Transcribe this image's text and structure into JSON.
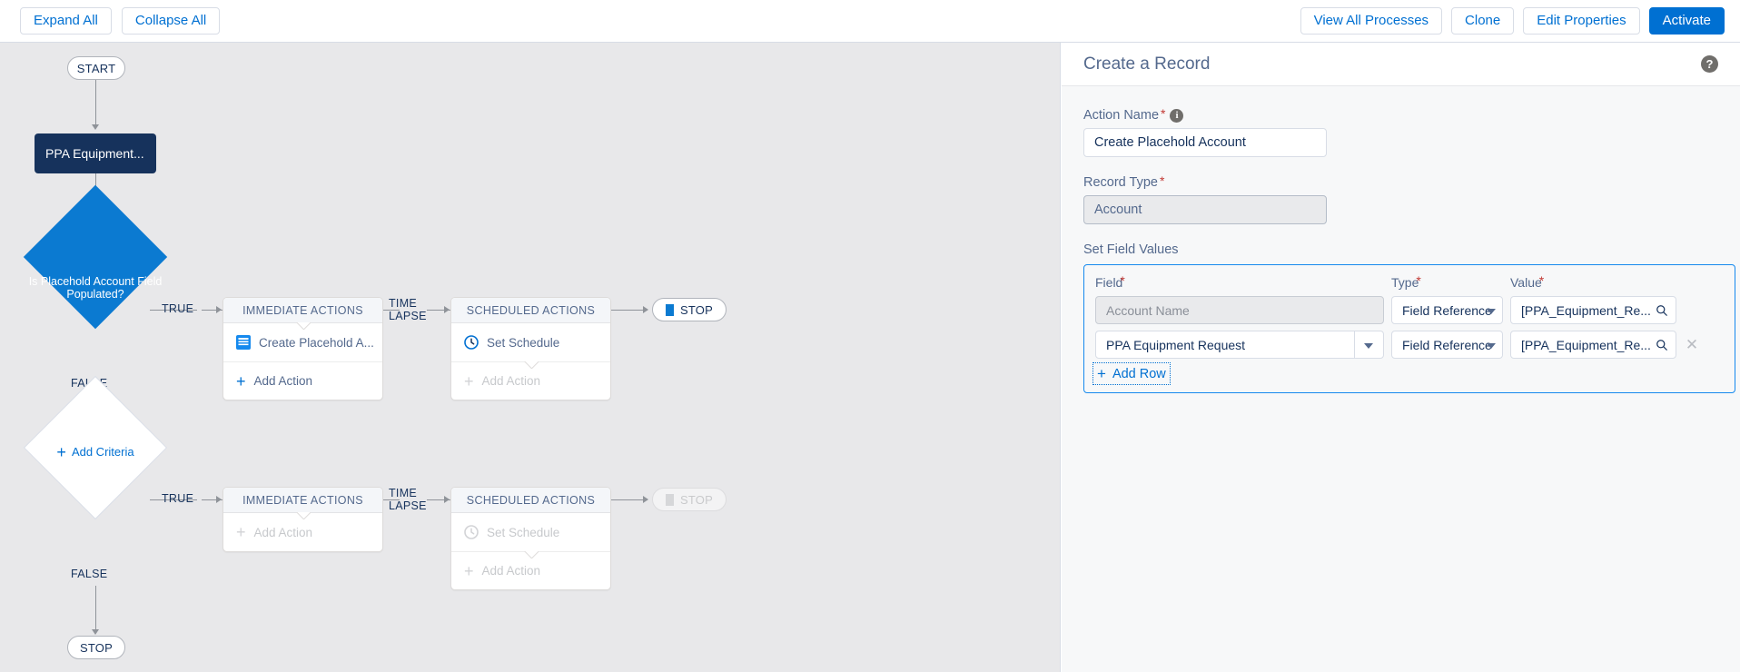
{
  "toolbar": {
    "left_buttons": [
      {
        "label": "Expand All",
        "name": "expand-all-button"
      },
      {
        "label": "Collapse All",
        "name": "collapse-all-button"
      }
    ],
    "right_buttons": [
      {
        "label": "View All Processes",
        "name": "view-all-processes-button"
      },
      {
        "label": "Clone",
        "name": "clone-button"
      },
      {
        "label": "Edit Properties",
        "name": "edit-properties-button"
      },
      {
        "label": "Activate",
        "name": "activate-button",
        "primary": true
      }
    ]
  },
  "canvas": {
    "start_label": "START",
    "object_node_label": "PPA Equipment...",
    "criteria_1": {
      "label": "Is Placehold Account Field Populated?",
      "true_label": "TRUE",
      "false_label": "FALSE",
      "immediate_header": "IMMEDIATE ACTIONS",
      "immediate_action": "Create Placehold A...",
      "immediate_add_action": "Add Action",
      "time_lapse_line1": "TIME",
      "time_lapse_line2": "LAPSE",
      "scheduled_header": "SCHEDULED ACTIONS",
      "set_schedule": "Set Schedule",
      "scheduled_add_action": "Add Action",
      "stop_label": "STOP"
    },
    "criteria_2": {
      "label": "Add Criteria",
      "true_label": "TRUE",
      "false_label": "FALSE",
      "immediate_header": "IMMEDIATE ACTIONS",
      "immediate_add_action": "Add Action",
      "time_lapse_line1": "TIME",
      "time_lapse_line2": "LAPSE",
      "scheduled_header": "SCHEDULED ACTIONS",
      "set_schedule": "Set Schedule",
      "scheduled_add_action": "Add Action",
      "stop_label": "STOP"
    },
    "end_stop_label": "STOP"
  },
  "panel": {
    "title": "Create a Record",
    "help_glyph": "?",
    "action_name": {
      "label": "Action Name",
      "required_mark": "*",
      "info_glyph": "i",
      "value": "Create Placehold Account"
    },
    "record_type": {
      "label": "Record Type",
      "required_mark": "*",
      "value": "Account"
    },
    "set_field_values": {
      "label": "Set Field Values",
      "columns": [
        {
          "label": "Field",
          "required_mark": "*"
        },
        {
          "label": "Type",
          "required_mark": "*"
        },
        {
          "label": "Value",
          "required_mark": "*"
        }
      ],
      "rows": [
        {
          "field": "Account Name",
          "field_readonly": true,
          "type": "Field Reference",
          "value": "[PPA_Equipment_Re...",
          "removable": false
        },
        {
          "field": "PPA Equipment Request",
          "field_readonly": false,
          "type": "Field Reference",
          "value": "[PPA_Equipment_Re...",
          "removable": true
        }
      ],
      "add_row_label": "Add Row"
    }
  },
  "colors": {
    "brand": "#0070d2",
    "criteria_blue": "#0b7ad1",
    "object_navy": "#16325c",
    "canvas_bg": "#e8e8ea",
    "required_red": "#c23934"
  }
}
